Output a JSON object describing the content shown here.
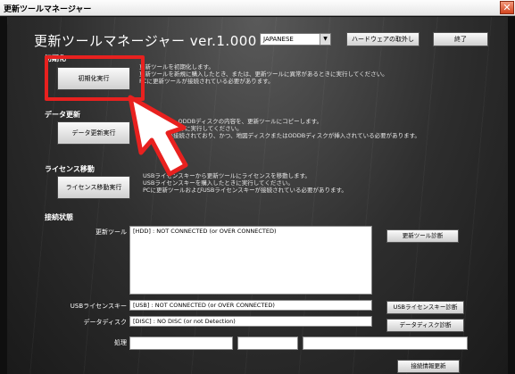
{
  "window": {
    "title": "更新ツールマネージャー"
  },
  "header": {
    "app_title": "更新ツールマネージャー ver.1.000",
    "language": "JAPANESE",
    "hardware_button": "ハードウェアの取外し",
    "exit_button": "終了"
  },
  "sections": {
    "init": {
      "title": "初期化",
      "button": "初期化実行",
      "desc": "更新ツールを初期化します。\n更新ツールを新規に購入したとき、または、更新ツールに異常があるときに実行してください。\nPCに更新ツールが接続されている必要があります。"
    },
    "data_update": {
      "title": "データ更新",
      "button": "データ更新実行",
      "desc": "ディスク、ODDBディスクの内容を、更新ツールにコピーします。\n購入したときに実行してください。\nツールが接続されており、かつ、地図ディスクまたはODDBディスクが挿入されている必要があります。"
    },
    "license": {
      "title": "ライセンス移動",
      "button": "ライセンス移動実行",
      "desc": "USBライセンスキーから更新ツールにライセンスを移動します。\nUSBライセンスキーを購入したときに実行してください。\nPCに更新ツールおよびUSBライセンスキーが接続されている必要があります。"
    }
  },
  "connection": {
    "title": "接続状態",
    "tool_label": "更新ツール",
    "tool_value": "[HDD] : NOT CONNECTED (or OVER CONNECTED)",
    "tool_button": "更新ツール診断",
    "usb_label": "USBライセンスキー",
    "usb_value": "[USB] : NOT CONNECTED (or OVER CONNECTED)",
    "usb_button": "USBライセンスキー診断",
    "disk_label": "データディスク",
    "disk_value": "[DISC] : NO DISC (or not Detection)",
    "disk_button": "データディスク診断",
    "process_label": "処理",
    "refresh_button": "接続情報更新"
  },
  "colors": {
    "highlight": "#e8211f",
    "arrow_fill": "#ffffff",
    "arrow_stroke": "#e8211f"
  }
}
